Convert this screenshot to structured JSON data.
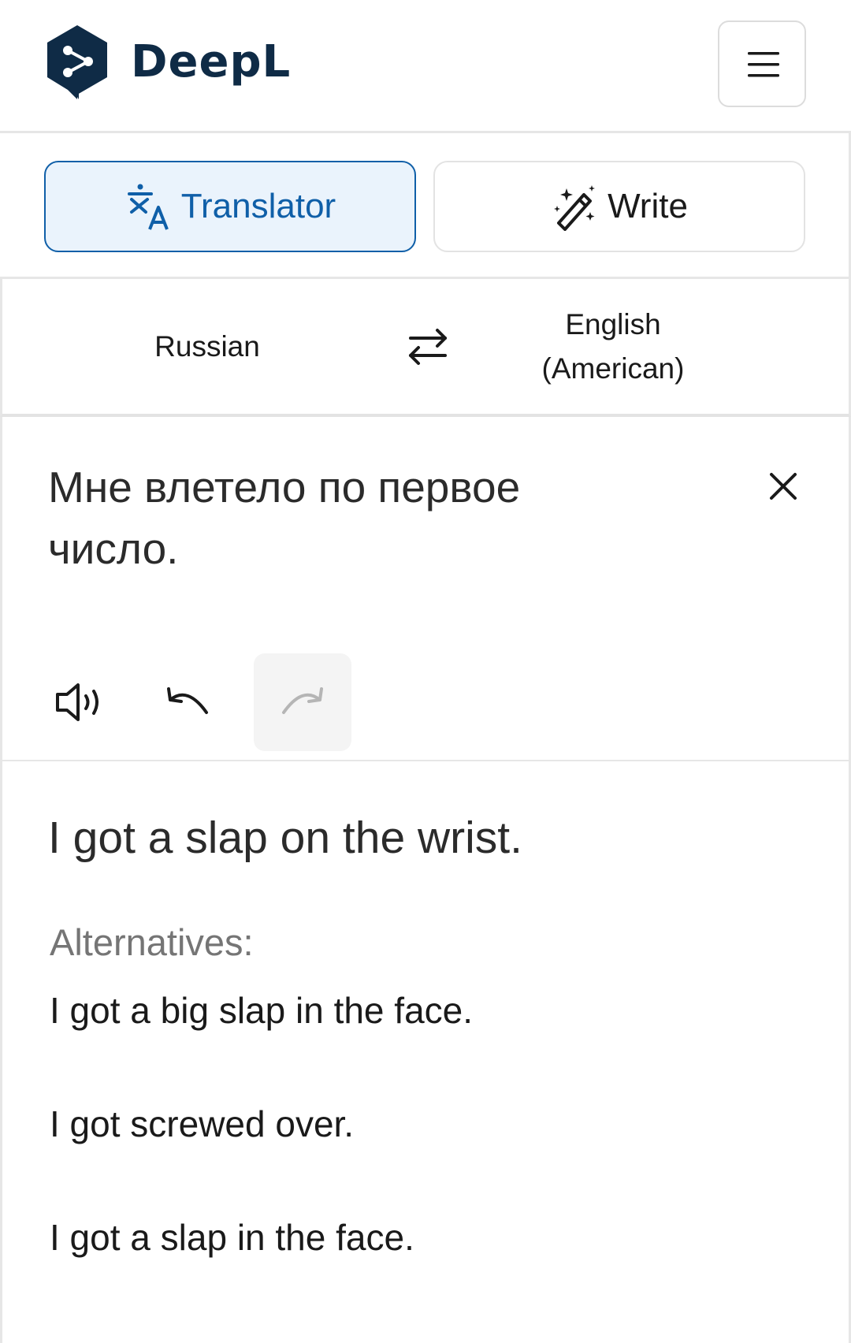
{
  "header": {
    "brand": "DeepL",
    "logo_icon": "deepl-logo-icon",
    "menu_icon": "hamburger-menu-icon"
  },
  "modes": {
    "translator_label": "Translator",
    "translator_icon": "translate-icon",
    "write_label": "Write",
    "write_icon": "magic-wand-icon",
    "active": "translator"
  },
  "languages": {
    "source": "Russian",
    "target": "English (American)",
    "swap_icon": "swap-arrows-icon"
  },
  "source": {
    "text": "Мне влетело по первое число.",
    "clear_icon": "close-icon",
    "tools": [
      "speaker-icon",
      "undo-icon",
      "redo-icon"
    ]
  },
  "target": {
    "translation": "I got a slap on the wrist.",
    "alternatives_label": "Alternatives:",
    "alternatives": [
      "I got a big slap in the face.",
      "I got screwed over.",
      "I got a slap in the face."
    ]
  },
  "colors": {
    "brand_navy": "#0f2b46",
    "accent_blue": "#0f5fa8",
    "active_tab_bg": "#eaf3fc",
    "muted_text": "#757575"
  }
}
